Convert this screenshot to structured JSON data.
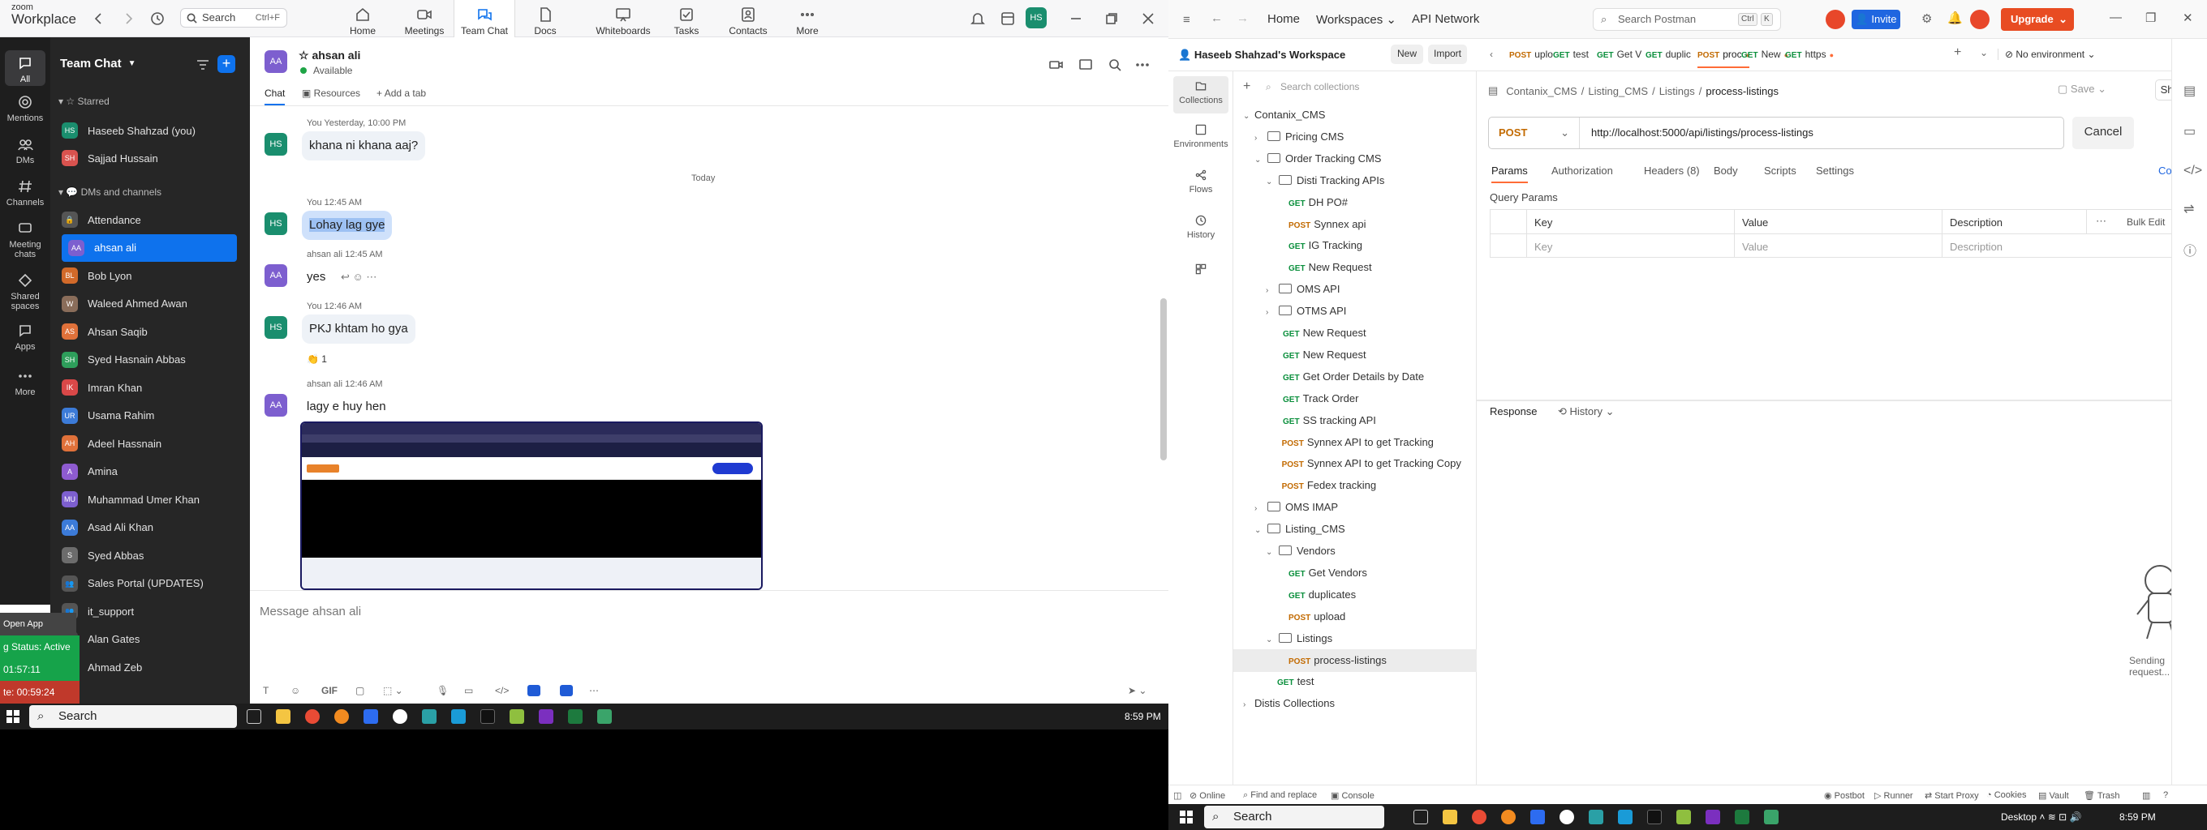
{
  "zoom": {
    "logo_top": "zoom",
    "logo_bottom": "Workplace",
    "search_placeholder": "Search",
    "search_shortcut": "Ctrl+F",
    "tabs": [
      "Home",
      "Meetings",
      "Team Chat",
      "Docs",
      "Whiteboards",
      "Tasks",
      "Contacts",
      "More"
    ],
    "user_initials": "HS",
    "rail": [
      "All",
      "Mentions",
      "DMs",
      "Channels",
      "Meeting chats",
      "Shared spaces",
      "Apps",
      "More"
    ],
    "sidebar_title": "Team Chat",
    "starred_label": "Starred",
    "starred": [
      {
        "name": "Haseeb Shahzad (you)",
        "ini": "HS",
        "color": "#1a8e6e"
      },
      {
        "name": "Sajjad Hussain",
        "ini": "SH",
        "color": "#d9534f"
      }
    ],
    "dm_label": "DMs and channels",
    "dms": [
      {
        "name": "Attendance",
        "ini": "🔒",
        "color": "#555"
      },
      {
        "name": "ahsan ali",
        "ini": "AA",
        "color": "#7d5fcf"
      },
      {
        "name": "Bob Lyon",
        "ini": "BL",
        "color": "#d26a2a"
      },
      {
        "name": "Waleed Ahmed Awan",
        "ini": "W",
        "color": "#8a6d5a"
      },
      {
        "name": "Ahsan Saqib",
        "ini": "AS",
        "color": "#e0713a"
      },
      {
        "name": "Syed Hasnain Abbas",
        "ini": "SH",
        "color": "#2e9e5b"
      },
      {
        "name": "Imran Khan",
        "ini": "IK",
        "color": "#d94848"
      },
      {
        "name": "Usama Rahim",
        "ini": "UR",
        "color": "#3c7bd8"
      },
      {
        "name": "Adeel Hassnain",
        "ini": "AH",
        "color": "#e0713a"
      },
      {
        "name": "Amina",
        "ini": "A",
        "color": "#8e5bd0"
      },
      {
        "name": "Muhammad Umer Khan",
        "ini": "MU",
        "color": "#7d5fcf"
      },
      {
        "name": "Asad Ali Khan",
        "ini": "AA",
        "color": "#3c7bd8"
      },
      {
        "name": "Syed Abbas",
        "ini": "S",
        "color": "#6c6c6c"
      },
      {
        "name": "Sales Portal (UPDATES)",
        "ini": "👥",
        "color": "#555"
      },
      {
        "name": "it_support",
        "ini": "👥",
        "color": "#555"
      },
      {
        "name": "Alan Gates",
        "ini": "AG",
        "color": "#444"
      },
      {
        "name": "Ahmad Zeb",
        "ini": "AZ",
        "color": "#444"
      }
    ],
    "chat_title": "ahsan ali",
    "chat_status": "Available",
    "chat_initials": "AA",
    "chat_tabs": [
      "Chat",
      "Resources",
      "Add a tab"
    ],
    "messages": [
      {
        "meta": "You  Yesterday, 10:00 PM",
        "text": "khana ni khana aaj?"
      },
      {
        "meta": "You  12:45 AM",
        "text": "Lohay lag gye"
      },
      {
        "meta": "ahsan ali  12:45 AM",
        "text": "yes"
      },
      {
        "meta": "You  12:46 AM",
        "text": "PKJ khtam ho gya"
      },
      {
        "meta": "ahsan ali  12:46 AM",
        "text": "lagy e huy hen"
      }
    ],
    "day_divider": "Today",
    "reaction": "👏 1",
    "input_placeholder": "Message ahsan ali",
    "gif_label": "GIF",
    "overlay": {
      "open_app": "Open App",
      "status": "g Status: Active",
      "timer1": "01:57:11",
      "timer2": "te: 00:59:24"
    },
    "taskbar_search": "Search",
    "clock": "8:59 PM"
  },
  "postman": {
    "nav": {
      "home": "Home",
      "workspaces": "Workspaces",
      "api_network": "API Network"
    },
    "search_placeholder": "Search Postman",
    "kbd1": "Ctrl",
    "kbd2": "K",
    "invite": "Invite",
    "upgrade": "Upgrade",
    "workspace": "Haseeb Shahzad's Workspace",
    "new_btn": "New",
    "import_btn": "Import",
    "tabs": [
      {
        "m": "POST",
        "t": "uplo"
      },
      {
        "m": "GET",
        "t": "test"
      },
      {
        "m": "GET",
        "t": "Get V"
      },
      {
        "m": "GET",
        "t": "duplic"
      },
      {
        "m": "POST",
        "t": "proc"
      },
      {
        "m": "GET",
        "t": "New"
      },
      {
        "m": "GET",
        "t": "https"
      }
    ],
    "env": "No environment",
    "rail": [
      "Collections",
      "Environments",
      "Flows",
      "History"
    ],
    "search_collections": "Search collections",
    "tree": [
      {
        "d": 0,
        "k": "root",
        "t": "Contanix_CMS"
      },
      {
        "d": 1,
        "k": "folder",
        "c": ">",
        "t": "Pricing CMS"
      },
      {
        "d": 1,
        "k": "folder",
        "c": "v",
        "t": "Order Tracking CMS"
      },
      {
        "d": 2,
        "k": "folder",
        "c": "v",
        "t": "Disti Tracking APIs"
      },
      {
        "d": 3,
        "k": "req",
        "m": "GET",
        "t": "DH PO#"
      },
      {
        "d": 3,
        "k": "req",
        "m": "POST",
        "t": "Synnex api"
      },
      {
        "d": 3,
        "k": "req",
        "m": "GET",
        "t": "IG Tracking"
      },
      {
        "d": 3,
        "k": "req",
        "m": "GET",
        "t": "New Request"
      },
      {
        "d": 2,
        "k": "folder",
        "c": ">",
        "t": "OMS API"
      },
      {
        "d": 2,
        "k": "folder",
        "c": ">",
        "t": "OTMS API"
      },
      {
        "d": 2.5,
        "k": "req",
        "m": "GET",
        "t": "New Request"
      },
      {
        "d": 2.5,
        "k": "req",
        "m": "GET",
        "t": "New Request"
      },
      {
        "d": 2.5,
        "k": "req",
        "m": "GET",
        "t": "Get Order Details by Date"
      },
      {
        "d": 2.5,
        "k": "req",
        "m": "GET",
        "t": "Track Order"
      },
      {
        "d": 2.5,
        "k": "req",
        "m": "GET",
        "t": "SS tracking API"
      },
      {
        "d": 2.4,
        "k": "req",
        "m": "POST",
        "t": "Synnex API to get Tracking"
      },
      {
        "d": 2.4,
        "k": "req",
        "m": "POST",
        "t": "Synnex API to get Tracking Copy"
      },
      {
        "d": 2.4,
        "k": "req",
        "m": "POST",
        "t": "Fedex tracking"
      },
      {
        "d": 1,
        "k": "folder",
        "c": ">",
        "t": "OMS IMAP"
      },
      {
        "d": 1,
        "k": "folder",
        "c": "v",
        "t": "Listing_CMS"
      },
      {
        "d": 2,
        "k": "folder",
        "c": "v",
        "t": "Vendors"
      },
      {
        "d": 3,
        "k": "req",
        "m": "GET",
        "t": "Get Vendors"
      },
      {
        "d": 3,
        "k": "req",
        "m": "GET",
        "t": "duplicates"
      },
      {
        "d": 3,
        "k": "req",
        "m": "POST",
        "t": "upload"
      },
      {
        "d": 2,
        "k": "folder",
        "c": "v",
        "t": "Listings"
      },
      {
        "d": 3,
        "k": "req",
        "m": "POST",
        "t": "process-listings",
        "sel": true
      },
      {
        "d": 2,
        "k": "req",
        "m": "GET",
        "t": "test"
      },
      {
        "d": 0,
        "k": "root",
        "c": ">",
        "t": "Distis Collections"
      }
    ],
    "breadcrumb": [
      "Contanix_CMS",
      "Listing_CMS",
      "Listings",
      "process-listings"
    ],
    "save": "Save",
    "share": "Share",
    "method": "POST",
    "url": "http://localhost:5000/api/listings/process-listings",
    "cancel": "Cancel",
    "req_tabs": [
      "Params",
      "Authorization",
      "Headers (8)",
      "Body",
      "Scripts",
      "Settings"
    ],
    "cookies": "Cookies",
    "query_params": "Query Params",
    "cols": [
      "Key",
      "Value",
      "Description"
    ],
    "bulk_edit": "Bulk Edit",
    "ph": [
      "Key",
      "Value",
      "Description"
    ],
    "response": "Response",
    "history": "History",
    "sending": "Sending request...",
    "status": [
      "Online",
      "Find and replace",
      "Console",
      "Postbot",
      "Runner",
      "Start Proxy",
      "Cookies",
      "Vault",
      "Trash"
    ],
    "taskbar_search": "Search",
    "desktop": "Desktop",
    "clock": "8:59 PM"
  }
}
